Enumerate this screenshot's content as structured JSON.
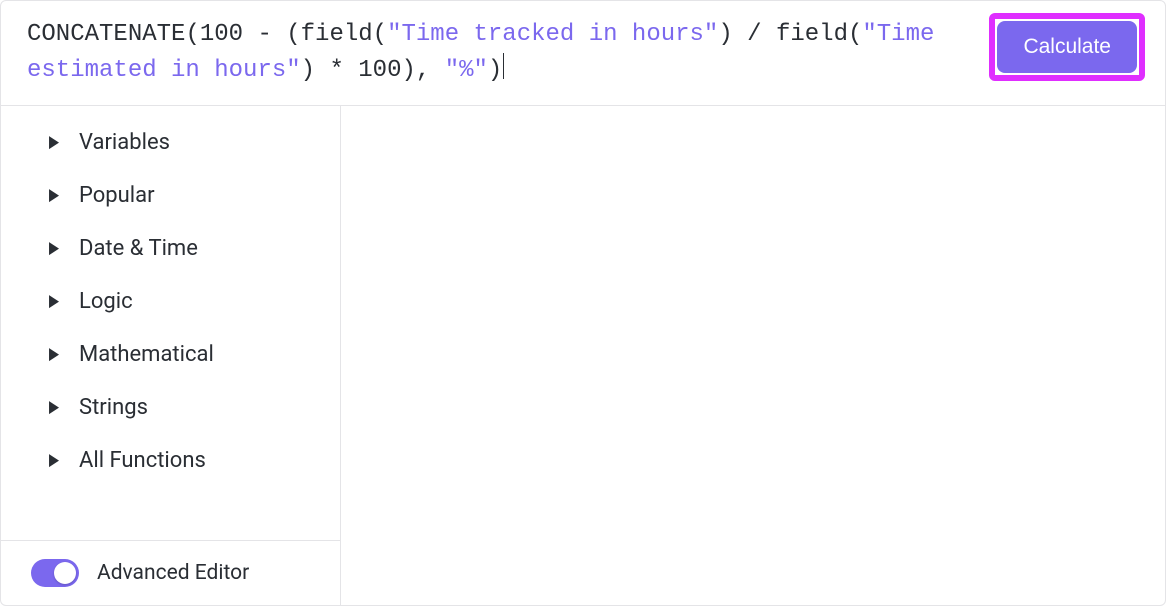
{
  "formula": {
    "tokens": [
      {
        "t": "fn",
        "v": "CONCATENATE"
      },
      {
        "t": "plain",
        "v": "(100 - ("
      },
      {
        "t": "fn",
        "v": "field"
      },
      {
        "t": "plain",
        "v": "("
      },
      {
        "t": "str",
        "v": "\"Time tracked in hours\""
      },
      {
        "t": "plain",
        "v": ") / "
      },
      {
        "t": "fn",
        "v": "field"
      },
      {
        "t": "plain",
        "v": "("
      },
      {
        "t": "str",
        "v": "\"Time estimated in hours\""
      },
      {
        "t": "plain",
        "v": ") * 100), "
      },
      {
        "t": "str",
        "v": "\"%\""
      },
      {
        "t": "plain",
        "v": ")"
      }
    ]
  },
  "calculate_label": "Calculate",
  "categories": [
    "Variables",
    "Popular",
    "Date & Time",
    "Logic",
    "Mathematical",
    "Strings",
    "All Functions"
  ],
  "advanced_editor_label": "Advanced Editor",
  "advanced_editor_on": true
}
